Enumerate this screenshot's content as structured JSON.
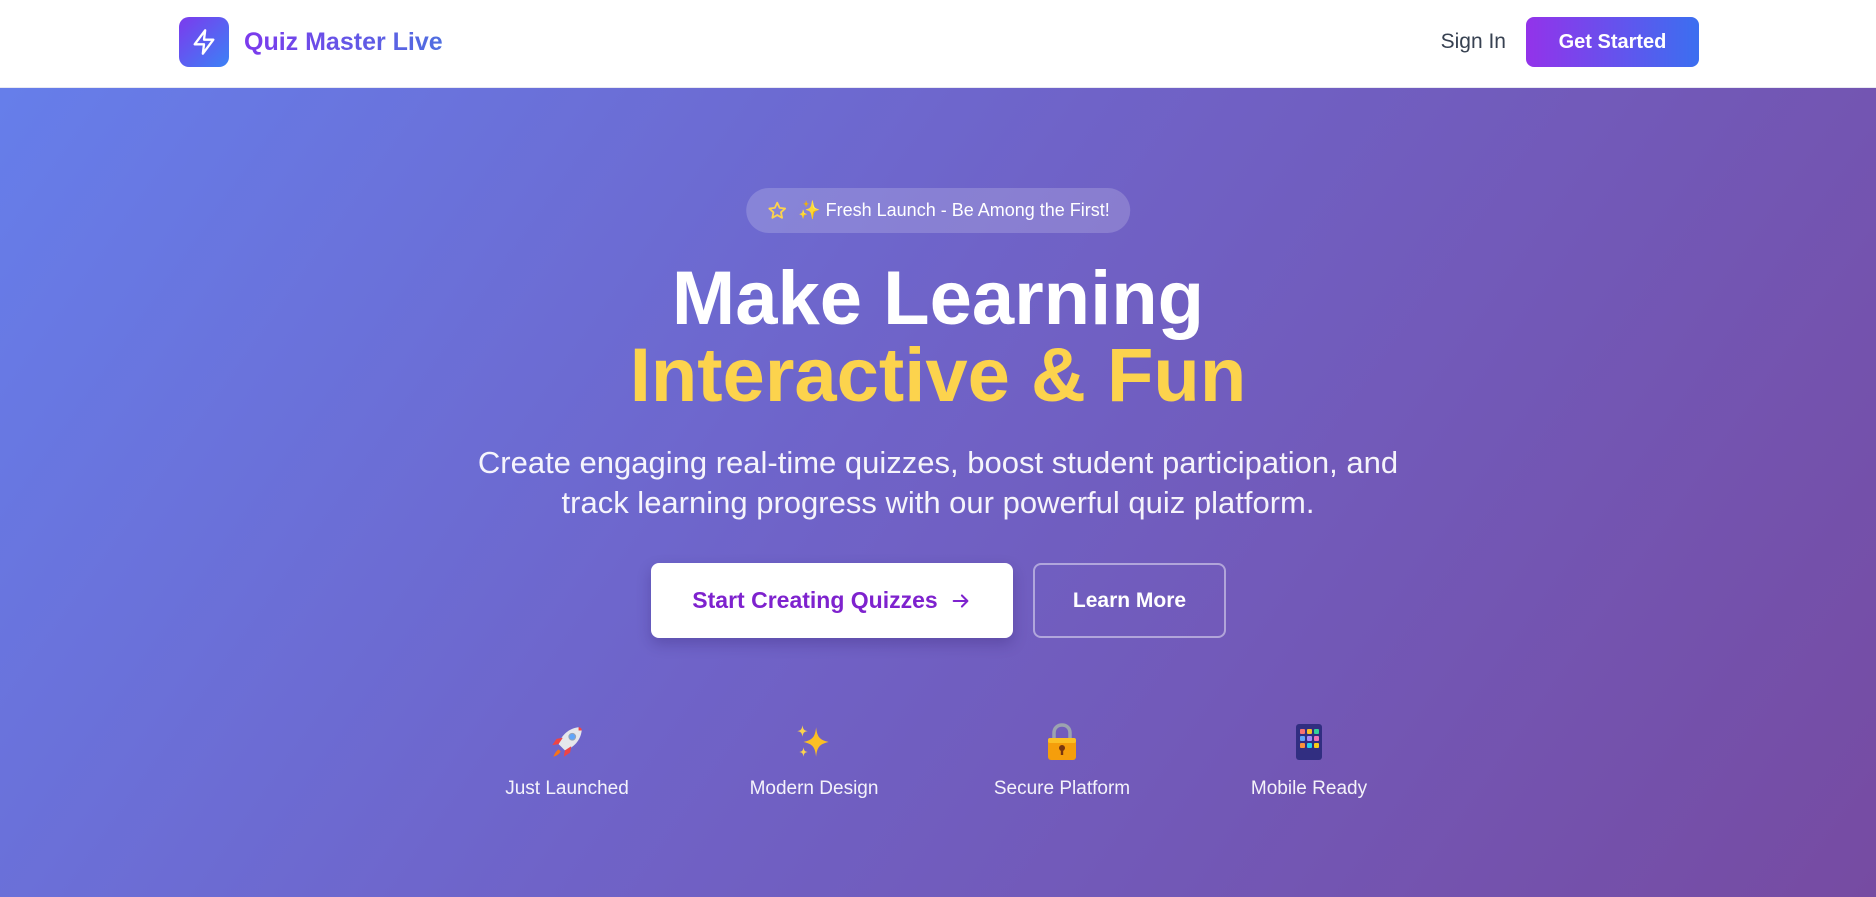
{
  "brand": {
    "name": "Quiz Master Live",
    "logo_icon": "lightning-bolt-icon"
  },
  "nav": {
    "sign_in": "Sign In",
    "get_started": "Get Started"
  },
  "hero": {
    "badge_icon": "star-outline-icon",
    "badge_text": "✨ Fresh Launch - Be Among the First!",
    "headline_line1": "Make Learning",
    "headline_line2": "Interactive & Fun",
    "subtitle": "Create engaging real-time quizzes, boost student participation, and track learning progress with our powerful quiz platform.",
    "primary_cta": "Start Creating Quizzes",
    "primary_cta_icon": "arrow-right-icon",
    "secondary_cta": "Learn More"
  },
  "features": [
    {
      "icon": "rocket-icon",
      "label": "Just Launched"
    },
    {
      "icon": "sparkles-icon",
      "label": "Modern Design"
    },
    {
      "icon": "lock-icon",
      "label": "Secure Platform"
    },
    {
      "icon": "mobile-app-grid-icon",
      "label": "Mobile Ready"
    }
  ],
  "colors": {
    "brand_purple": "#7c3aed",
    "brand_blue": "#3b82f6",
    "hero_gradient_start": "#667eea",
    "hero_gradient_end": "#764ba2",
    "headline_accent": "#fcd34d",
    "primary_cta_text": "#7e22ce"
  }
}
